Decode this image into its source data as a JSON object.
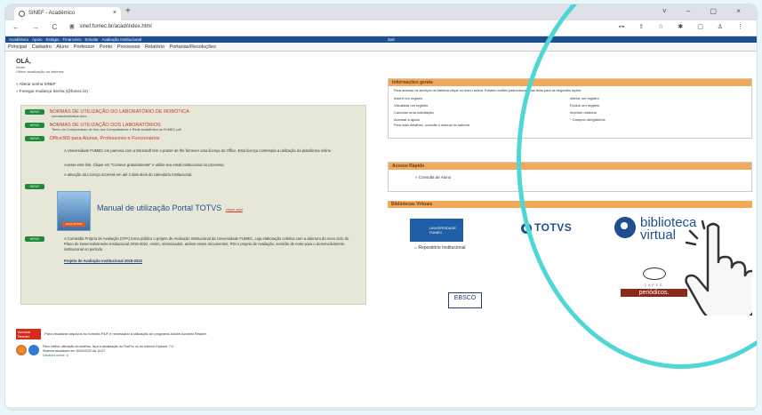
{
  "browser": {
    "tab_title": "SINEF - Acadêmico",
    "close_glyph": "×",
    "new_tab_glyph": "+",
    "url": "sinef.fumec.br/acad/index.html",
    "window_controls": "˅ – ▢ ×",
    "nav_glyphs": "← → C ⌂",
    "toolbar_icons": "⊶ ⇪ ☆ ✱ ▢ ♙ ⋮"
  },
  "app": {
    "bar_text": "Acadêmico · Apoio · Estágio · Financeiro · Ensalar · Avaliação Institucional",
    "bar_right": "Sair",
    "menu": [
      "Principal",
      "Cadastro",
      "Aluno",
      "Professor",
      "Ponto",
      "Processos",
      "Relatório",
      "Portarias/Resoluções"
    ]
  },
  "greeting": {
    "hello": "OLÁ,",
    "user": "Aluno",
    "last_access": "Último atualização do sistema:",
    "links": [
      "» Alterar senha SINEF",
      "» Fonegar mudança Senha (@fumec.br)"
    ]
  },
  "news": [
    {
      "badge": "NOVO",
      "title": "NORMAS DE UTILIZAÇÃO DO LABORATÓRIO DE ROBÓTICA",
      "desc": "normasderobotica.docx"
    },
    {
      "badge": "NOVO",
      "title": "NORMAS DE UTILIZAÇÃO DOS LABORATÓRIOS",
      "desc": "Termo de Compromisso de Uso dos Computadores e Rede Acadêmica da FUMEC.pdf"
    },
    {
      "badge": "NOVO",
      "title": "Office365 para Alunos, Professores e Funcionários",
      "desc": ""
    }
  ],
  "office_text": [
    "A Universidade FUMEC em parceria com a Microsoft tem o prazer de lhe fornecer uma licença do Office. Esta licença contempla a utilização da plataforma online.",
    "Acesse este link. Clique em \"Comece gratuitamente\" e utilize seu email institucional no processo.",
    "A ativação da Licença ocorrerá em até 2 dias úteis do calendário institucional."
  ],
  "manual": {
    "badge": "NOVO",
    "title": "Manual de utilização Portal TOTVS",
    "link": "clique aqui",
    "thumb_button": "Portal TOTVS"
  },
  "cpa": {
    "badge": "NOVO",
    "text": "A Comissão Própria de Avaliação (CPA) torna público o projeto de Avaliação Institucional da Universidade FUMEC, cuja elaboração coletiva com a abertura do novo ciclo do Plano de Desenvolvimento Institucional 2018-2022. Assim, sintonizados, ambos esses documentos, PDI e projeto de Avaliação, servirão de norte para o desenvolvimento institucional no período.",
    "link": "Projeto de Avaliação Institucional 2018-2022"
  },
  "footer": {
    "acrobat_label": "Acrobat Reader",
    "pdf_note": "Para visualizar arquivos no formato PDF é necessário a utilização do programa Adobe Acrobat Reader.",
    "browser_note": "Para melhor utilização do sistema, faça a atualização do FireFox ou do Internet Explorer 7.0.",
    "updated": "Sistema atualizado em 10/02/2022 às 10:27",
    "online": "Usuários online: 8"
  },
  "general_info": {
    "title": "Informações gerais",
    "intro": "Para acessar os serviços do sistema clique no menu acima. Existem botões padronizados nas telas para as seguintes ações:",
    "actions": [
      "Inserir um registro",
      "Alterar um registro",
      "Visualizar um registro",
      "Excluir um registro",
      "Cancelar uma solicitação",
      "Imprimir relatório",
      "Acessar a ajuda",
      "* Campos obrigatórios"
    ],
    "outro": "Para mais detalhes, consulte o manual do sistema."
  },
  "quick_access": {
    "title": "Acesso Rápido",
    "item": "» Consulta de Aluno"
  },
  "libraries": {
    "title": "Bibliotecas Virtuais",
    "fumec": "UNIVERSIDADE FUMEC",
    "repo": "Repositório Institucional",
    "totvs": "TOTVS",
    "bv1": "biblioteca",
    "bv2": "virtual",
    "ebsco": "EBSCO",
    "capes": "CAPES",
    "periodicos": "periódicos."
  }
}
